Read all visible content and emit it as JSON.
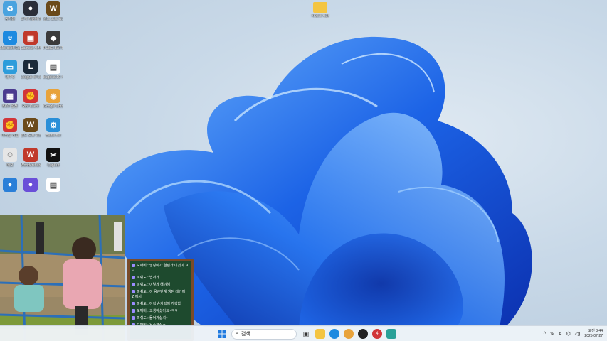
{
  "desktop_icons": [
    {
      "label": "휴지통",
      "icon": "recycle-bin-icon",
      "color": "#4aa3df",
      "glyph": "♻"
    },
    {
      "label": "고객 지원이 필요하신..",
      "icon": "support-app-icon",
      "color": "#2b2f3a",
      "glyph": "●"
    },
    {
      "label": "월드 오브 워크래프트",
      "icon": "warcraft-icon",
      "color": "#6b4a1a",
      "glyph": "W"
    },
    {
      "label": "Microsoft Edge",
      "icon": "edge-icon",
      "color": "#1d8ae0",
      "glyph": "e"
    },
    {
      "label": "Camera 사진",
      "icon": "camera-app-icon",
      "color": "#c0392b",
      "glyph": "▣"
    },
    {
      "label": "PUBG BATTLEG..",
      "icon": "pubg-icon",
      "color": "#3b3b3b",
      "glyph": "◆"
    },
    {
      "label": "내 PC",
      "icon": "this-pc-icon",
      "color": "#2d9cdb",
      "glyph": "▭"
    },
    {
      "label": "League of Legends",
      "icon": "league-of-legends-icon",
      "color": "#1b2a3a",
      "glyph": "L"
    },
    {
      "label": "bugbear10 시작",
      "icon": "document-icon",
      "color": "#ffffff",
      "glyph": "▤"
    },
    {
      "label": "BOX 설정",
      "icon": "grid-app-icon",
      "color": "#4b3b8f",
      "glyph": "▦"
    },
    {
      "label": "Riot Client",
      "icon": "riot-client-icon",
      "color": "#d13639",
      "glyph": "✊"
    },
    {
      "label": "Google Chrome",
      "icon": "chrome-icon",
      "color": "#e8a33b",
      "glyph": "◉"
    },
    {
      "label": "이터널 리턴",
      "icon": "riot-game-icon",
      "color": "#d13639",
      "glyph": "✊"
    },
    {
      "label": "월드 오브 워크래프트",
      "icon": "warcraft-icon",
      "color": "#6b4a1a",
      "glyph": "W"
    },
    {
      "label": "Battle.net",
      "icon": "settings-app-icon",
      "color": "#2a8fd8",
      "glyph": "⚙"
    },
    {
      "label": "메모",
      "icon": "anime-app-icon",
      "color": "#e6e6e6",
      "glyph": "☺"
    },
    {
      "label": "Wondershare",
      "icon": "wondershare-icon",
      "color": "#c0392b",
      "glyph": "W"
    },
    {
      "label": "CapCut",
      "icon": "capcut-icon",
      "color": "#111111",
      "glyph": "✂"
    },
    {
      "label": "",
      "icon": "app-icon-partial",
      "color": "#2a7fd8",
      "glyph": "●"
    },
    {
      "label": "",
      "icon": "app-icon-partial",
      "color": "#6a4fd8",
      "glyph": "●"
    },
    {
      "label": "",
      "icon": "file-icon-partial",
      "color": "#ffffff",
      "glyph": "▤"
    }
  ],
  "top_folder": {
    "label": "카메라 사진",
    "icon": "folder-icon"
  },
  "chat_overlay": {
    "messages": [
      {
        "name": "도깨비",
        "text": "도깨비 : 엉덩이가 열린가 이것이 ㅋㅋ"
      },
      {
        "name": "피쉬도",
        "text": "피쉬도 : 빕서가"
      },
      {
        "name": "피쉬도",
        "text": "피쉬도 : 이렇게 해야해"
      },
      {
        "name": "피쉬도",
        "text": "피쉬도 : 이 용근단계 냉된 레인이 였어서"
      },
      {
        "name": "피쉬도",
        "text": "피쉬도 : 아직 손가락이 가락함"
      },
      {
        "name": "도깨비",
        "text": "도깨비 : 고생하셨어요~ㅋㅋ"
      },
      {
        "name": "피쉬도",
        "text": "피쉬도 : 들어가십셔~"
      },
      {
        "name": "도깨비",
        "text": "도깨비 : 욕수무십쇼"
      }
    ]
  },
  "taskbar": {
    "search_placeholder": "검색",
    "clock_time": "오전 3:44",
    "clock_date": "2025-07-27",
    "ime": "A",
    "notification_badge": "4"
  },
  "colors": {
    "wallpaper_bloom": "#1f6fe0",
    "taskbar": "#ecf2f8",
    "chat_board": "#1e4a2e",
    "chat_frame": "#7a4b2a"
  }
}
